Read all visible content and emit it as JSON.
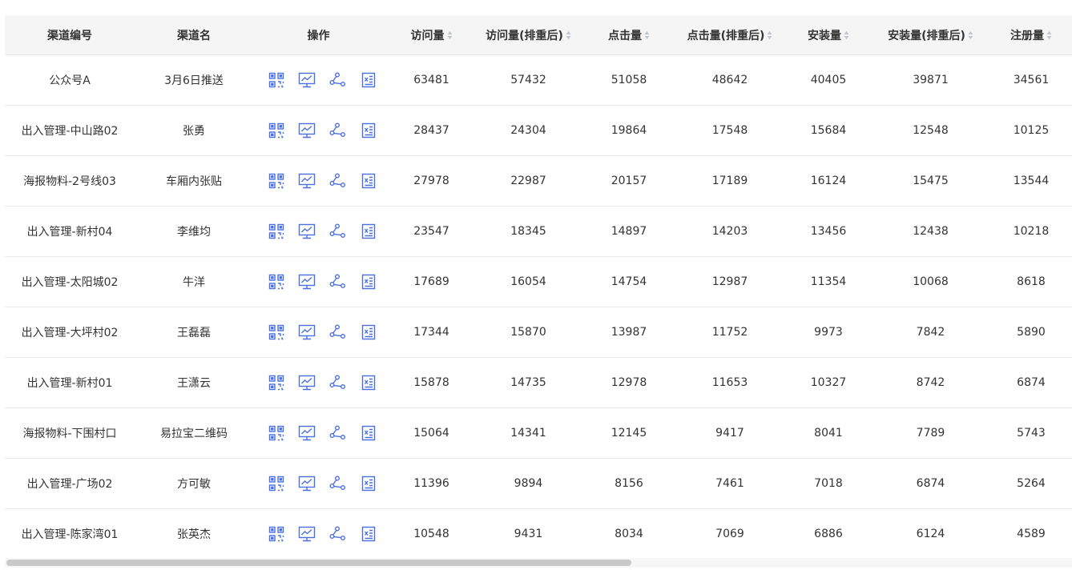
{
  "table": {
    "columns": [
      {
        "label": "渠道编号",
        "sortable": false
      },
      {
        "label": "渠道名",
        "sortable": false
      },
      {
        "label": "操作",
        "sortable": false
      },
      {
        "label": "访问量",
        "sortable": true
      },
      {
        "label": "访问量(排重后)",
        "sortable": true
      },
      {
        "label": "点击量",
        "sortable": true
      },
      {
        "label": "点击量(排重后)",
        "sortable": true
      },
      {
        "label": "安装量",
        "sortable": true
      },
      {
        "label": "安装量(排重后)",
        "sortable": true
      },
      {
        "label": "注册量",
        "sortable": true
      }
    ],
    "operation_icons": [
      "qrcode-icon",
      "chart-icon",
      "share-icon",
      "export-excel-icon"
    ],
    "rows": [
      {
        "code": "公众号A",
        "name": "3月6日推送",
        "visits": "63481",
        "visits_dedup": "57432",
        "clicks": "51058",
        "clicks_dedup": "48642",
        "installs": "40405",
        "installs_dedup": "39871",
        "registrations": "34561"
      },
      {
        "code": "出入管理-中山路02",
        "name": "张勇",
        "visits": "28437",
        "visits_dedup": "24304",
        "clicks": "19864",
        "clicks_dedup": "17548",
        "installs": "15684",
        "installs_dedup": "12548",
        "registrations": "10125"
      },
      {
        "code": "海报物料-2号线03",
        "name": "车厢内张贴",
        "visits": "27978",
        "visits_dedup": "22987",
        "clicks": "20157",
        "clicks_dedup": "17189",
        "installs": "16124",
        "installs_dedup": "15475",
        "registrations": "13544"
      },
      {
        "code": "出入管理-新村04",
        "name": "李维均",
        "visits": "23547",
        "visits_dedup": "18345",
        "clicks": "14897",
        "clicks_dedup": "14203",
        "installs": "13456",
        "installs_dedup": "12438",
        "registrations": "10218"
      },
      {
        "code": "出入管理-太阳城02",
        "name": "牛洋",
        "visits": "17689",
        "visits_dedup": "16054",
        "clicks": "14754",
        "clicks_dedup": "12987",
        "installs": "11354",
        "installs_dedup": "10068",
        "registrations": "8618"
      },
      {
        "code": "出入管理-大坪村02",
        "name": "王磊磊",
        "visits": "17344",
        "visits_dedup": "15870",
        "clicks": "13987",
        "clicks_dedup": "11752",
        "installs": "9973",
        "installs_dedup": "7842",
        "registrations": "5890"
      },
      {
        "code": "出入管理-新村01",
        "name": "王潇云",
        "visits": "15878",
        "visits_dedup": "14735",
        "clicks": "12978",
        "clicks_dedup": "11653",
        "installs": "10327",
        "installs_dedup": "8742",
        "registrations": "6874"
      },
      {
        "code": "海报物料-下围村口",
        "name": "易拉宝二维码",
        "visits": "15064",
        "visits_dedup": "14341",
        "clicks": "12145",
        "clicks_dedup": "9417",
        "installs": "8041",
        "installs_dedup": "7789",
        "registrations": "5743"
      },
      {
        "code": "出入管理-广场02",
        "name": "方可敏",
        "visits": "11396",
        "visits_dedup": "9894",
        "clicks": "8156",
        "clicks_dedup": "7461",
        "installs": "7018",
        "installs_dedup": "6874",
        "registrations": "5264"
      },
      {
        "code": "出入管理-陈家湾01",
        "name": "张英杰",
        "visits": "10548",
        "visits_dedup": "9431",
        "clicks": "8034",
        "clicks_dedup": "7069",
        "installs": "6886",
        "installs_dedup": "6124",
        "registrations": "4589"
      }
    ]
  },
  "colors": {
    "icon_blue": "#4a6fe0",
    "header_bg": "#f5f5f5",
    "row_border": "#ebebeb",
    "sort_caret": "#c0c4cc",
    "scrollbar_thumb": "#c9c9c9"
  },
  "scroll": {
    "horizontal_position_fraction": 0.0,
    "visible_fraction": 0.58
  }
}
